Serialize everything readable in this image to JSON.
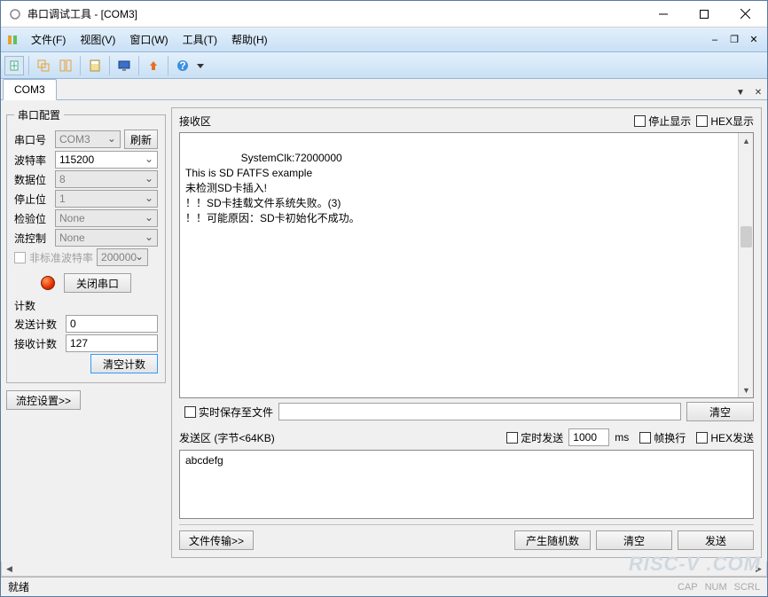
{
  "window": {
    "title": "串口调试工具 - [COM3]"
  },
  "menu": {
    "file": "文件(F)",
    "view": "视图(V)",
    "window": "窗口(W)",
    "tools": "工具(T)",
    "help": "帮助(H)"
  },
  "tab": {
    "name": "COM3"
  },
  "config": {
    "legend": "串口配置",
    "port_label": "串口号",
    "port_value": "COM3",
    "refresh": "刷新",
    "baud_label": "波特率",
    "baud_value": "115200",
    "data_label": "数据位",
    "data_value": "8",
    "stop_label": "停止位",
    "stop_value": "1",
    "parity_label": "检验位",
    "parity_value": "None",
    "flow_label": "流控制",
    "flow_value": "None",
    "nonstd_label": "非标准波特率",
    "nonstd_value": "200000",
    "close_btn": "关闭串口",
    "count_legend": "计数",
    "send_count_label": "发送计数",
    "send_count_value": "0",
    "recv_count_label": "接收计数",
    "recv_count_value": "127",
    "clear_count": "清空计数",
    "flow_settings": "流控设置>>"
  },
  "recv": {
    "legend": "接收区",
    "stop_disp": "停止显示",
    "hex_disp": "HEX显示",
    "text": "SystemClk:72000000\nThis is SD FATFS example\n未检测SD卡插入!\n！！SD卡挂载文件系统失败。(3)\n！！可能原因：SD卡初始化不成功。",
    "save_label": "实时保存至文件",
    "clear_btn": "清空"
  },
  "send": {
    "legend": "发送区 (字节<64KB)",
    "timed_label": "定时发送",
    "timed_value": "1000",
    "timed_unit": "ms",
    "wrap_label": "帧换行",
    "hex_label": "HEX发送",
    "text": "abcdefg",
    "file_btn": "文件传输>>",
    "rand_btn": "产生随机数",
    "clear_btn": "清空",
    "send_btn": "发送"
  },
  "status": {
    "ready": "就绪",
    "cap": "CAP",
    "num": "NUM",
    "scrl": "SCRL"
  },
  "watermark": "RISC-V .COM"
}
